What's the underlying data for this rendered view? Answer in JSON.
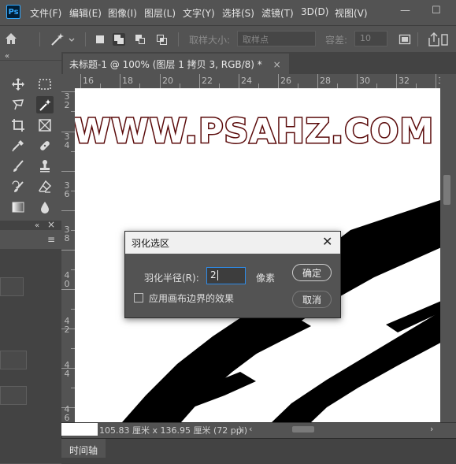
{
  "app": {
    "logo": "Ps"
  },
  "menu": [
    "文件(F)",
    "编辑(E)",
    "图像(I)",
    "图层(L)",
    "文字(Y)",
    "选择(S)",
    "滤镜(T)",
    "3D(D)",
    "视图(V)"
  ],
  "window_controls": {
    "minimize": "—",
    "maximize": "☐"
  },
  "options_bar": {
    "sample_size_label": "取样大小:",
    "sample_size_value": "取样点",
    "tolerance_label": "容差:",
    "tolerance_value": "10"
  },
  "document": {
    "tab_title": "未标题-1 @ 100% (图层 1 拷贝 3, RGB/8) *",
    "tab_close": "×",
    "canvas_text": "WWW.PSAHZ.COM",
    "status_size": "105.83 厘米 x 136.95 厘米 (72 ppi)",
    "status_arrow": "〉"
  },
  "ruler": {
    "h_labels": [
      "16",
      "18",
      "20",
      "22",
      "24",
      "26",
      "28",
      "30",
      "32",
      "34",
      "36"
    ],
    "v_labels": [
      "3\n2",
      "3\n4",
      "3\n6",
      "3\n8",
      "4\n0",
      "4\n2",
      "4\n4",
      "4\n6"
    ]
  },
  "timeline": {
    "tab_label": "时间轴"
  },
  "dialog": {
    "title": "羽化选区",
    "close": "✕",
    "radius_label": "羽化半径(R):",
    "radius_value": "2",
    "unit": "像素",
    "checkbox_label": "应用画布边界的效果",
    "ok": "确定",
    "cancel": "取消"
  },
  "colors": {
    "panel": "#535353",
    "panel_dark": "#434343",
    "canvas": "#ffffff",
    "text_fill": "#ffffff",
    "text_stroke": "#5a0a0a",
    "input_border": "#2e8be8"
  }
}
